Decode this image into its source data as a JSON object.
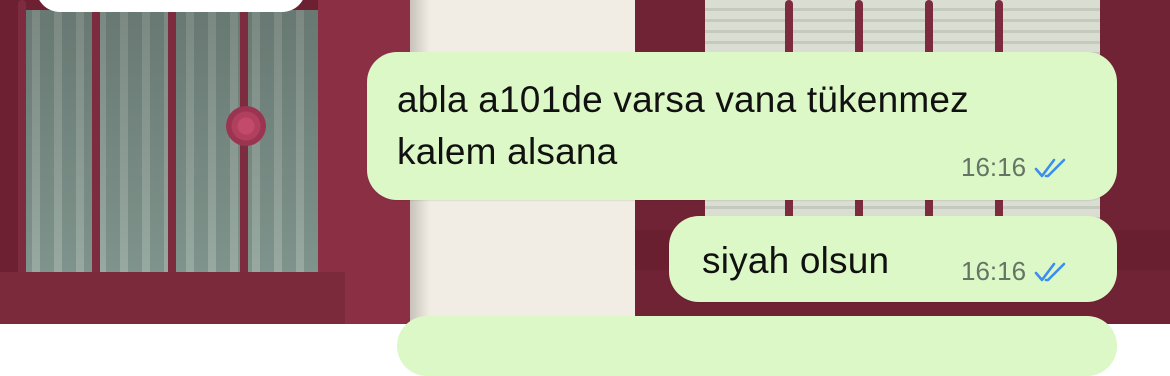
{
  "messages": [
    {
      "text_line1": "abla a101de varsa vana tükenmez",
      "text_line2": "kalem alsana",
      "time": "16:16",
      "status": "read"
    },
    {
      "text": "siyah olsun",
      "time": "16:16",
      "status": "read"
    }
  ],
  "colors": {
    "outgoing_bubble": "#dcf8c6",
    "read_ticks": "#3b8ef0",
    "timestamp": "#667466"
  },
  "icons": {
    "read_receipt": "double-check-icon"
  }
}
